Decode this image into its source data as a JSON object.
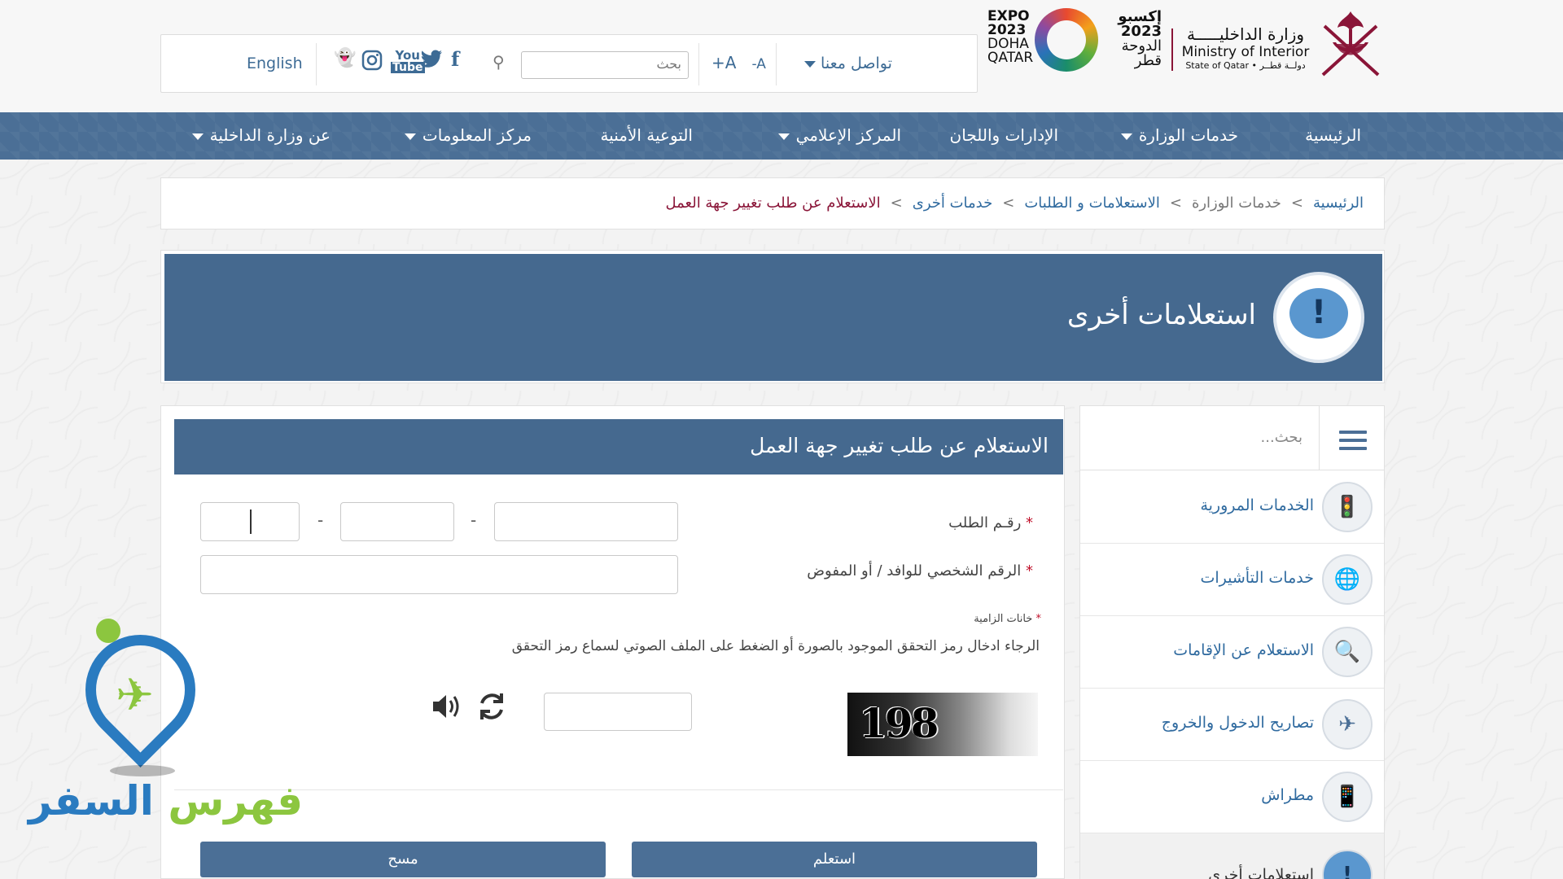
{
  "header": {
    "english_label": "English",
    "search_placeholder": "بحث",
    "font_increase": "+A",
    "font_decrease": "-A",
    "contact_label": "تواصل معنا",
    "social_icons": [
      "snapchat-icon",
      "instagram-icon",
      "youtube-icon",
      "twitter-icon",
      "facebook-icon"
    ],
    "expo": {
      "en_lines": [
        "EXPO",
        "2023",
        "DOHA",
        "QATAR"
      ],
      "ar_lines": [
        "إكسبو",
        "2023",
        "الدوحة",
        "قطر"
      ]
    },
    "ministry": {
      "ar": "وزارة الداخليـــــة",
      "en": "Ministry of Interior",
      "state": "State of Qatar • دولــة قطــر"
    }
  },
  "nav": {
    "items": [
      {
        "label": "الرئيسية",
        "dropdown": false
      },
      {
        "label": "خدمات الوزارة",
        "dropdown": true
      },
      {
        "label": "الإدارات واللجان",
        "dropdown": false
      },
      {
        "label": "المركز الإعلامي",
        "dropdown": true
      },
      {
        "label": "التوعية الأمنية",
        "dropdown": false
      },
      {
        "label": "مركز المعلومات",
        "dropdown": true
      },
      {
        "label": "عن وزارة الداخلية",
        "dropdown": true
      }
    ]
  },
  "breadcrumb": {
    "items": [
      "الرئيسية",
      "خدمات الوزارة",
      "الاستعلامات و الطلبات",
      "خدمات أخرى"
    ],
    "current": "الاستعلام عن طلب تغيير جهة العمل",
    "separator": ">"
  },
  "banner": {
    "title": "استعلامات أخرى",
    "icon_symbol": "!"
  },
  "form": {
    "title": "الاستعلام عن طلب تغيير جهة العمل",
    "request_number_label": "رقـم الطلب",
    "required_mark": "*",
    "dash": "-",
    "personal_id_label": "الرقم الشخصي للوافد / أو المفوض",
    "required_fields_note": "خانات الزامية",
    "captcha_hint": "الرجاء ادخال رمز التحقق الموجود بالصورة أو الضغط على الملف الصوتي لسماع رمز التحقق",
    "captcha_code": "198",
    "submit_label": "استعلم",
    "clear_label": "مسح"
  },
  "sidebar": {
    "search_placeholder": "بحث...",
    "items": [
      {
        "label": "الخدمات المرورية",
        "icon": "traffic-light-icon",
        "glyph": "🚦"
      },
      {
        "label": "خدمات التأشيرات",
        "icon": "globe-icon",
        "glyph": "🌐"
      },
      {
        "label": "الاستعلام عن الإقامات",
        "icon": "magnifier-icon",
        "glyph": "🔍"
      },
      {
        "label": "تصاريح الدخول والخروج",
        "icon": "airplane-icon",
        "glyph": "✈"
      },
      {
        "label": "مطراش",
        "icon": "phone-user-icon",
        "glyph": "📱"
      },
      {
        "label": "استعلامات أخرى",
        "icon": "exclamation-icon",
        "glyph": "!"
      }
    ]
  },
  "watermark": {
    "text_green": "فهرس",
    "text_blue": "السفر"
  },
  "colors": {
    "primary": "#4b6f96",
    "banner": "#45698f",
    "link": "#2f6a9f",
    "current_crumb": "#8a1538",
    "required": "#c0102a"
  }
}
